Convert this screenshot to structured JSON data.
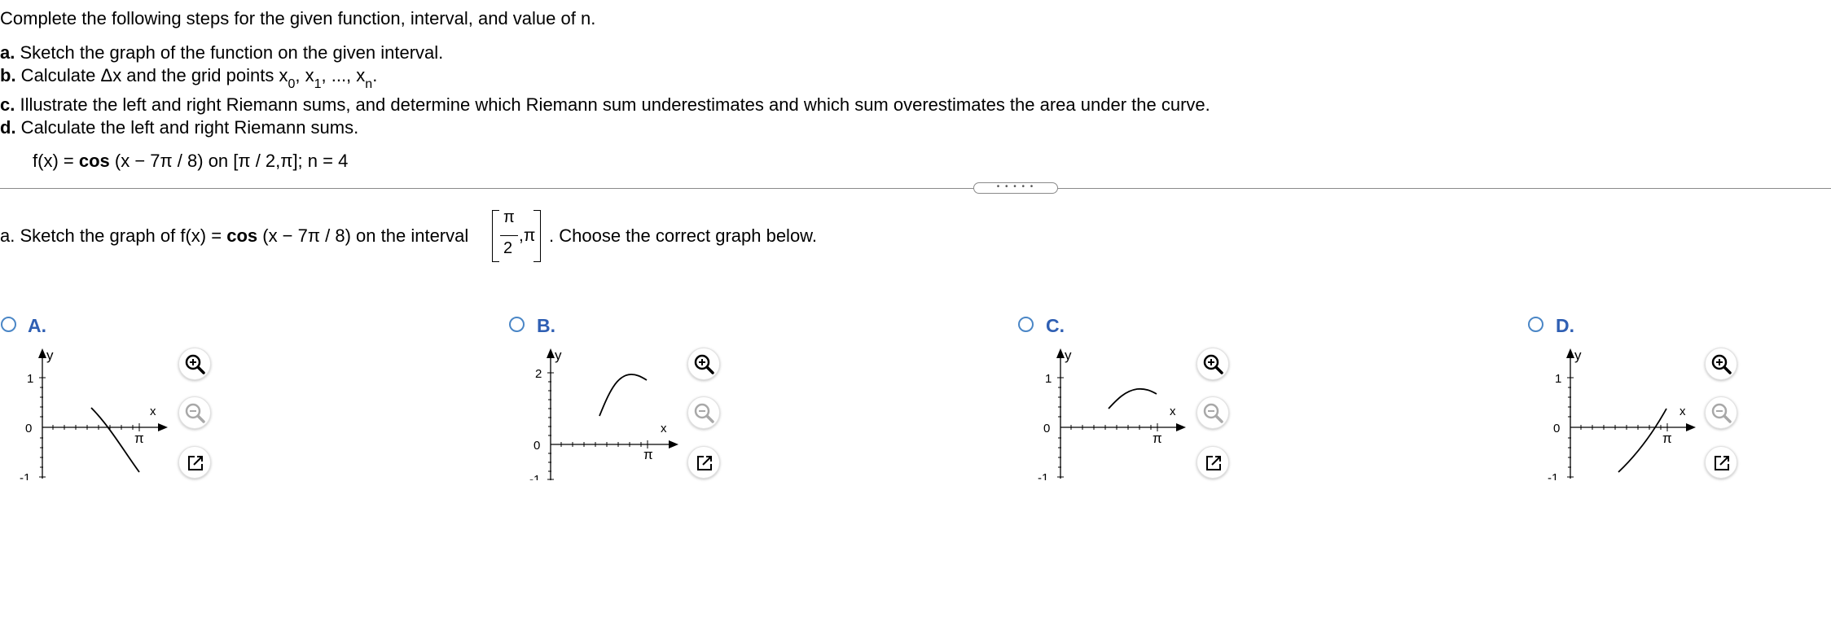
{
  "instructions": {
    "intro": "Complete the following steps for the given function, interval, and value of n.",
    "step_a_letter": "a.",
    "step_a_text": " Sketch the graph of the function on the given interval.",
    "step_b_letter": "b.",
    "step_b_text": " Calculate Δx and the grid points x",
    "step_b_sub0": "0",
    "step_b_sep1": ", x",
    "step_b_sub1": "1",
    "step_b_sep2": ", ..., x",
    "step_b_subn": "n",
    "step_b_end": ".",
    "step_c_letter": "c.",
    "step_c_text": " Illustrate the left and right Riemann sums, and determine which Riemann sum underestimates and which sum overestimates the area under the curve.",
    "step_d_letter": "d.",
    "step_d_text": " Calculate the left and right Riemann sums.",
    "function_prefix": "f(x) = ",
    "function_cos": "cos",
    "function_suffix": " (x − 7π / 8) on [π / 2,π]; n = 4"
  },
  "divider": {
    "handle_label": "• • • • •"
  },
  "question": {
    "prefix": "a. Sketch the graph of f(x) = ",
    "cos": "cos",
    "middle": " (x − 7π / 8) on the interval",
    "frac_num": "π",
    "frac_den": "2",
    "after_frac": ",π",
    "suffix": ". Choose the correct graph below."
  },
  "options": [
    {
      "letter": "A.",
      "y_ticks": [
        "1",
        "0",
        "-1"
      ],
      "x_label": "x",
      "y_label": "y",
      "pi_label": "π"
    },
    {
      "letter": "B.",
      "y_ticks": [
        "2",
        "0",
        "-1"
      ],
      "x_label": "x",
      "y_label": "y",
      "pi_label": "π"
    },
    {
      "letter": "C.",
      "y_ticks": [
        "1",
        "0",
        "-1"
      ],
      "x_label": "x",
      "y_label": "y",
      "pi_label": "π"
    },
    {
      "letter": "D.",
      "y_ticks": [
        "1",
        "0",
        "-1"
      ],
      "x_label": "x",
      "y_label": "y",
      "pi_label": "π"
    }
  ],
  "colors": {
    "radio_border": "#4a86c6",
    "option_letter": "#2f5fb3",
    "divider": "#8a8a8a"
  },
  "icons": [
    "zoom-in-icon",
    "zoom-out-icon",
    "open-external-icon"
  ]
}
